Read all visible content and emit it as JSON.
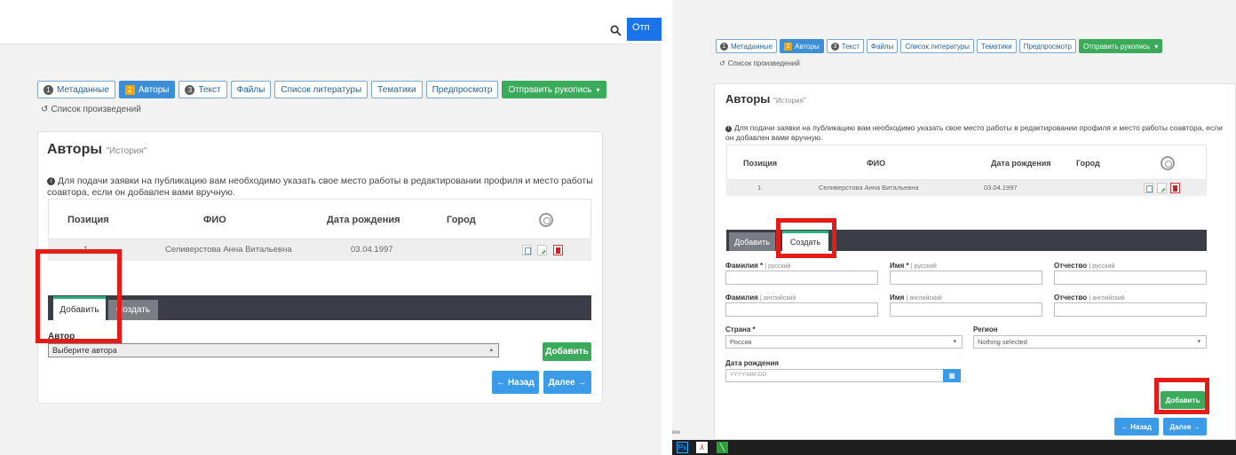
{
  "search_button_cut": "Отп",
  "tabs": [
    {
      "num": "1",
      "label": "Метаданные",
      "state": "normal"
    },
    {
      "num": "2",
      "label": "Авторы",
      "state": "active"
    },
    {
      "num": "3",
      "label": "Текст",
      "state": "normal"
    },
    {
      "num": "",
      "label": "Файлы",
      "state": "normal"
    },
    {
      "num": "",
      "label": "Список литературы",
      "state": "normal"
    },
    {
      "num": "",
      "label": "Тематики",
      "state": "normal"
    },
    {
      "num": "",
      "label": "Предпросмотр",
      "state": "normal"
    },
    {
      "num": "",
      "label": "Отправить рукопись",
      "state": "green"
    }
  ],
  "works_link": "Список произведений",
  "card": {
    "title": "Авторы",
    "subtitle": "\"История\"",
    "notice": "Для подачи заявки на публикацию вам необходимо указать свое место работы в редактировании профиля и место работы соавтора, если он добавлен вами вручную."
  },
  "table": {
    "headers": [
      "Позиция",
      "ФИО",
      "Дата рождения",
      "Город"
    ],
    "rows": [
      {
        "position": "1",
        "name": "Селиверстова Анна Витальевна",
        "birth": "03.04.1997",
        "city": ""
      }
    ]
  },
  "subtabs": {
    "add": "Добавить",
    "create": "Создать"
  },
  "add_form": {
    "author_label": "Автор",
    "author_select": "Выберите автора",
    "add_button": "Добавить"
  },
  "nav": {
    "back": "← Назад",
    "next": "Далее →"
  },
  "create_form": {
    "surname_ru": "Фамилия *",
    "name_ru": "Имя *",
    "patronymic_ru": "Отчество",
    "lang_ru": "| русский",
    "surname_en": "Фамилия",
    "name_en": "Имя",
    "patronymic_en": "Отчество",
    "lang_en": "| английский",
    "country_label": "Страна *",
    "country_value": "Россия",
    "region_label": "Регион",
    "region_value": "Nothing selected",
    "birth_label": "Дата рождения",
    "birth_placeholder": "YYYY-MM-DD",
    "add_button": "Добавить"
  },
  "taskbar": {
    "view_text": "iew"
  },
  "colors": {
    "highlight": "#e41b17",
    "green": "#3aaa5b",
    "blue": "#3c9be8"
  }
}
